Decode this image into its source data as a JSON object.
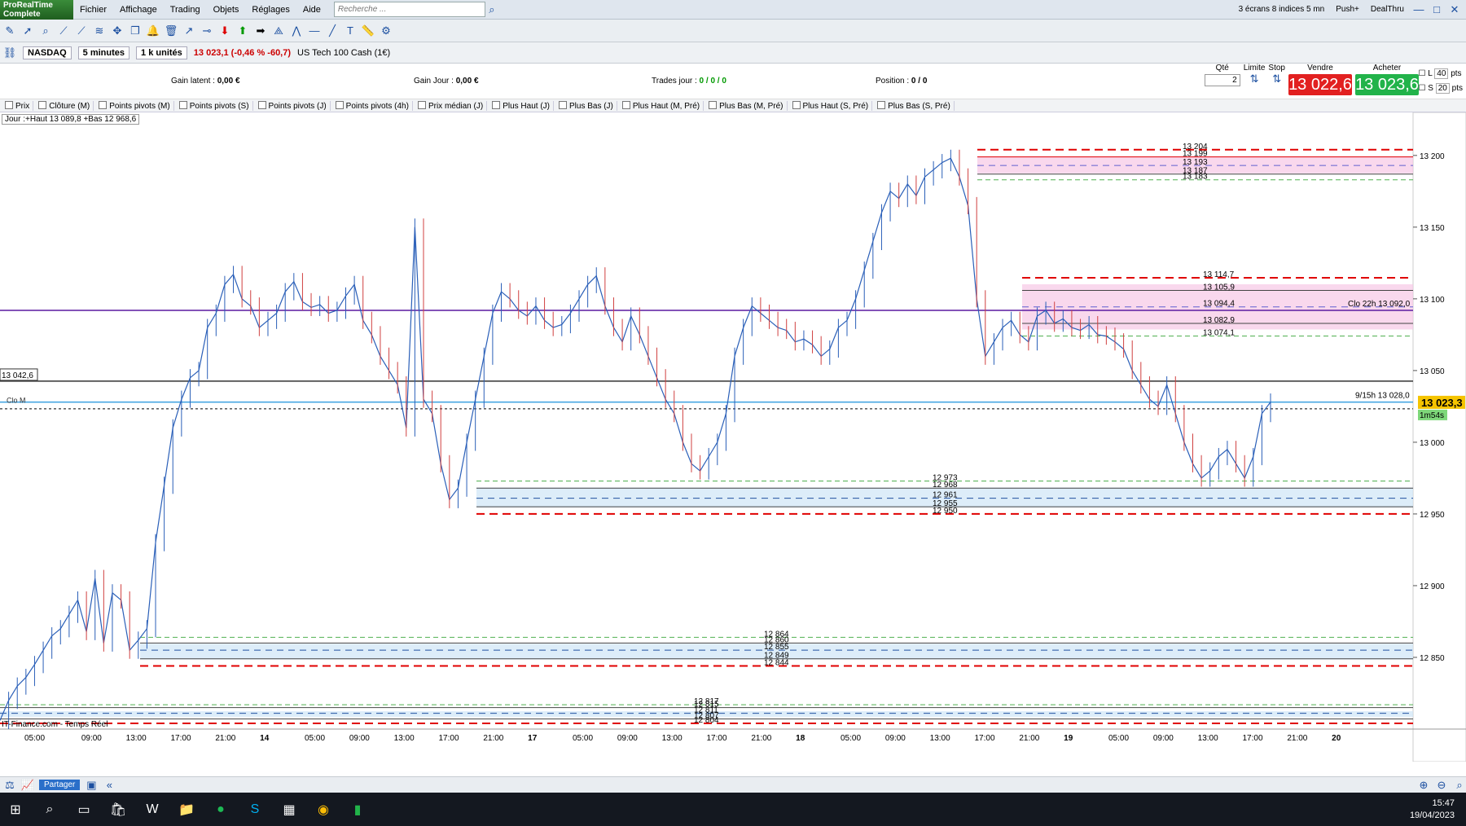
{
  "app": {
    "logo_line1": "ProRealTime",
    "logo_line2": "Complete"
  },
  "menu": [
    "Fichier",
    "Affichage",
    "Trading",
    "Objets",
    "Réglages",
    "Aide"
  ],
  "search": {
    "placeholder": "Recherche ..."
  },
  "top_right": {
    "screens": "3 écrans 8 indices 5 mn",
    "push": "Push+",
    "dealthru": "DealThru"
  },
  "instrument": {
    "symbol": "NASDAQ",
    "timeframe": "5 minutes",
    "units": "1 k unités",
    "quote": "13 023,1 (-0,46 % -60,7)",
    "name": "US Tech 100 Cash (1€)"
  },
  "pnl": {
    "gain_latent_label": "Gain latent :",
    "gain_latent": "0,00 €",
    "gain_jour_label": "Gain Jour :",
    "gain_jour": "0,00 €",
    "trades_label": "Trades jour :",
    "trades": "0 / 0 / 0",
    "position_label": "Position :",
    "position": "0",
    "position2": "/ 0"
  },
  "order": {
    "qte_label": "Qté",
    "qte": "2",
    "limite_label": "Limite",
    "stop_label": "Stop",
    "vendre_label": "Vendre",
    "vendre": "13 022,6",
    "acheter_label": "Acheter",
    "acheter": "13 023,6",
    "l_label": "L",
    "l_pts": "40",
    "s_label": "S",
    "s_pts": "20",
    "pts": "pts"
  },
  "indicators": [
    "Prix",
    "Clôture (M)",
    "Points pivots (M)",
    "Points pivots (S)",
    "Points pivots (J)",
    "Points pivots (4h)",
    "Prix médian (J)",
    "Plus Haut (J)",
    "Plus Bas (J)",
    "Plus Haut (M, Pré)",
    "Plus Bas (M, Pré)",
    "Plus Haut (S, Pré)",
    "Plus Bas (S, Pré)"
  ],
  "day_info": "Jour :+Haut 13 089,8 +Bas 12 968,6",
  "bottom": {
    "share": "Partager"
  },
  "clock": {
    "time": "15:47",
    "date": "19/04/2023"
  },
  "chart_data": {
    "type": "line",
    "title": "NASDAQ US Tech 100 Cash (1€) 5 minutes",
    "ylim": [
      12800,
      13230
    ],
    "y_ticks": [
      13200,
      13150,
      13100,
      13050,
      13000,
      12950,
      12900,
      12850
    ],
    "y_tick_labels": [
      "13 200",
      "13 150",
      "13 100",
      "13 050",
      "13 000",
      "12 950",
      "12 900",
      "12 850"
    ],
    "x_tick_labels": [
      "05:00",
      "09:00",
      "13:00",
      "17:00",
      "21:00",
      "14",
      "05:00",
      "09:00",
      "13:00",
      "17:00",
      "21:00",
      "17",
      "05:00",
      "09:00",
      "13:00",
      "17:00",
      "21:00",
      "18",
      "05:00",
      "09:00",
      "13:00",
      "17:00",
      "21:00",
      "19",
      "05:00",
      "09:00",
      "13:00",
      "17:00",
      "21:00",
      "20"
    ],
    "last_price": "13 023,3",
    "timer": "1m54s",
    "left_label": "13 042,6",
    "clo_m_label": "Clo M",
    "clo_22h_label": "Clo 22h 13 092,0",
    "h915_label": "9/15h 13 028,0",
    "source_label": "IT-Finance.com - Temps Réel",
    "levels": [
      {
        "value": 13204,
        "label": "13 204",
        "color": "#e00000",
        "dash": "big"
      },
      {
        "value": 13199,
        "label": "13 199",
        "color": "#e00000",
        "dash": "none"
      },
      {
        "value": 13193,
        "label": "13 193",
        "color": "#6060d0",
        "dash": "mid"
      },
      {
        "value": 13187,
        "label": "13 187",
        "color": "#444444",
        "dash": "none"
      },
      {
        "value": 13183,
        "label": "13 183",
        "color": "#50b050",
        "dash": "small"
      },
      {
        "value": 13114.7,
        "label": "13 114,7",
        "color": "#e00000",
        "dash": "big"
      },
      {
        "value": 13105.9,
        "label": "13 105,9",
        "color": "#444444",
        "dash": "none"
      },
      {
        "value": 13094.4,
        "label": "13 094,4",
        "color": "#6060d0",
        "dash": "mid"
      },
      {
        "value": 13082.9,
        "label": "13 082,9",
        "color": "#444444",
        "dash": "none"
      },
      {
        "value": 13074.1,
        "label": "13 074,1",
        "color": "#50b050",
        "dash": "small"
      },
      {
        "value": 12973,
        "label": "12 973",
        "color": "#50b050",
        "dash": "small"
      },
      {
        "value": 12968,
        "label": "12 968",
        "color": "#444444",
        "dash": "none"
      },
      {
        "value": 12961,
        "label": "12 961",
        "color": "#2050a0",
        "dash": "mid"
      },
      {
        "value": 12955,
        "label": "12 955",
        "color": "#444444",
        "dash": "none"
      },
      {
        "value": 12950,
        "label": "12 950",
        "color": "#e00000",
        "dash": "big"
      },
      {
        "value": 12864,
        "label": "12 864",
        "color": "#50b050",
        "dash": "small"
      },
      {
        "value": 12860,
        "label": "12 860",
        "color": "#444444",
        "dash": "none"
      },
      {
        "value": 12855,
        "label": "12 855",
        "color": "#2050a0",
        "dash": "mid"
      },
      {
        "value": 12849,
        "label": "12 849",
        "color": "#444444",
        "dash": "none"
      },
      {
        "value": 12844,
        "label": "12 844",
        "color": "#e00000",
        "dash": "big"
      },
      {
        "value": 12817,
        "label": "12 817",
        "color": "#50b050",
        "dash": "small"
      },
      {
        "value": 12815,
        "label": "12 815",
        "color": "#444444",
        "dash": "none"
      },
      {
        "value": 12811,
        "label": "12 811",
        "color": "#2050a0",
        "dash": "mid"
      },
      {
        "value": 12807,
        "label": "12 807",
        "color": "#444444",
        "dash": "none"
      },
      {
        "value": 12804,
        "label": "12 804",
        "color": "#e00000",
        "dash": "big"
      }
    ],
    "horizontal_lines": [
      {
        "value": 13092,
        "color": "#5a1aa0"
      },
      {
        "value": 13042.6,
        "color": "#333333"
      },
      {
        "value": 13028,
        "color": "#3aa0e0"
      }
    ],
    "price_path": [
      12806,
      12820,
      12830,
      12836,
      12845,
      12855,
      12865,
      12870,
      12880,
      12890,
      12868,
      12905,
      12860,
      12895,
      12890,
      12855,
      12862,
      12870,
      12930,
      12970,
      13010,
      13030,
      13045,
      13050,
      13080,
      13090,
      13110,
      13117,
      13100,
      13095,
      13080,
      13085,
      13090,
      13105,
      13112,
      13098,
      13094,
      13096,
      13090,
      13092,
      13102,
      13110,
      13085,
      13075,
      13060,
      13050,
      13040,
      13010,
      13150,
      13030,
      13020,
      12985,
      12960,
      12968,
      13000,
      13030,
      13060,
      13090,
      13105,
      13100,
      13092,
      13088,
      13095,
      13085,
      13080,
      13082,
      13090,
      13100,
      13110,
      13116,
      13095,
      13080,
      13070,
      13088,
      13075,
      13060,
      13045,
      13030,
      13020,
      13000,
      12985,
      12980,
      12990,
      13000,
      13020,
      13060,
      13080,
      13095,
      13090,
      13085,
      13080,
      13078,
      13070,
      13072,
      13068,
      13060,
      13065,
      13080,
      13085,
      13100,
      13120,
      13140,
      13160,
      13175,
      13170,
      13180,
      13172,
      13185,
      13190,
      13195,
      13198,
      13185,
      13165,
      13100,
      13060,
      13070,
      13080,
      13085,
      13075,
      13070,
      13088,
      13092,
      13083,
      13086,
      13080,
      13078,
      13082,
      13075,
      13074,
      13070,
      13065,
      13050,
      13040,
      13030,
      13025,
      13040,
      13020,
      13000,
      12985,
      12975,
      12980,
      12990,
      12995,
      12985,
      12975,
      12990,
      13020,
      13028
    ]
  }
}
